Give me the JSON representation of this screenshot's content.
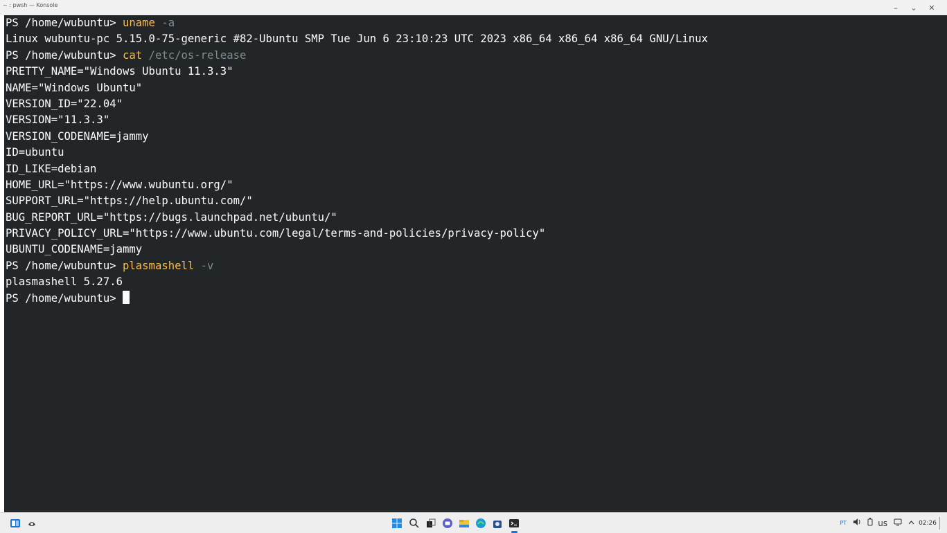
{
  "window": {
    "title": "~ : pwsh — Konsole",
    "controls": {
      "minimize": "–",
      "maximize": "⌄",
      "close": "✕"
    }
  },
  "terminal": {
    "lines": [
      {
        "prompt": "PS /home/wubuntu> ",
        "cmd": "uname",
        "arg": " -a"
      },
      {
        "text": "Linux wubuntu-pc 5.15.0-75-generic #82-Ubuntu SMP Tue Jun 6 23:10:23 UTC 2023 x86_64 x86_64 x86_64 GNU/Linux"
      },
      {
        "prompt": "PS /home/wubuntu> ",
        "cmd": "cat",
        "arg": " /etc/os-release"
      },
      {
        "text": "PRETTY_NAME=\"Windows Ubuntu 11.3.3\""
      },
      {
        "text": "NAME=\"Windows Ubuntu\""
      },
      {
        "text": "VERSION_ID=\"22.04\""
      },
      {
        "text": "VERSION=\"11.3.3\""
      },
      {
        "text": "VERSION_CODENAME=jammy"
      },
      {
        "text": "ID=ubuntu"
      },
      {
        "text": "ID_LIKE=debian"
      },
      {
        "text": "HOME_URL=\"https://www.wubuntu.org/\""
      },
      {
        "text": "SUPPORT_URL=\"https://help.ubuntu.com/\""
      },
      {
        "text": "BUG_REPORT_URL=\"https://bugs.launchpad.net/ubuntu/\""
      },
      {
        "text": "PRIVACY_POLICY_URL=\"https://www.ubuntu.com/legal/terms-and-policies/privacy-policy\""
      },
      {
        "text": "UBUNTU_CODENAME=jammy"
      },
      {
        "prompt": "PS /home/wubuntu> ",
        "cmd": "plasmashell",
        "arg": " -v"
      },
      {
        "text": "plasmashell 5.27.6"
      },
      {
        "prompt": "PS /home/wubuntu> ",
        "cursor": true
      }
    ]
  },
  "taskbar": {
    "left_icons": [
      "widgets-icon",
      "copilot-icon"
    ],
    "center_icons": [
      "start-icon",
      "search-icon",
      "task-view-icon",
      "chat-icon",
      "file-explorer-icon",
      "edge-icon",
      "store-icon",
      "terminal-icon"
    ],
    "tray": {
      "language": "PT",
      "keyboard": "us",
      "time": "02:26"
    }
  },
  "colors": {
    "terminal_bg": "#232629",
    "terminal_fg": "#fcfcfc",
    "command": "#fdbc4b",
    "argument": "#7f8c8d"
  }
}
